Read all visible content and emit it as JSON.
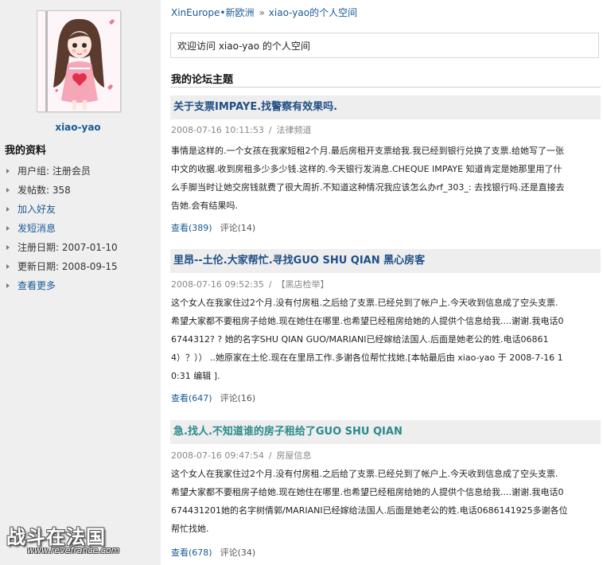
{
  "profile": {
    "username": "xiao-yao",
    "section_title": "我的资料",
    "items": [
      {
        "label": "用户组: 注册会员"
      },
      {
        "label": "发帖数: 358"
      },
      {
        "label": "加入好友"
      },
      {
        "label": "发短消息"
      },
      {
        "label": "注册日期: 2007-01-10"
      },
      {
        "label": "更新日期: 2008-09-15"
      },
      {
        "label": "查看更多"
      }
    ]
  },
  "breadcrumb": {
    "site": "XinEurope•新欧洲",
    "separator": "»",
    "current": "xiao-yao的个人空间"
  },
  "welcome_text": "欢迎访问  xiao-yao 的个人空间",
  "forum_section_title": "我的论坛主题",
  "posts": [
    {
      "title": "关于支票IMPAYE.找警察有效果吗.",
      "date": "2008-07-16 10:11:53",
      "category": "法律频道",
      "body": [
        "事情是这样的.一个女孩在我家短租2个月.最后房租开支票给我.我已经到银行兑换了支票.给她写了一张",
        "中文的收据.收到房租多少多少钱.这样的.今天银行发消息.CHEQUE IMPAYE 知道肯定是她那里用了什",
        "么手脚当时让她交房钱就费了很大周折.不知道这种情况我应该怎么办rf_303_: 去找银行吗.还是直接去",
        "告她.会有结果吗."
      ],
      "views": "查看(389)",
      "comments": "评论(14)"
    },
    {
      "title": "里昂--土伦.大家帮忙.寻找GUO SHU QIAN 黑心房客",
      "date": "2008-07-16 09:52:35",
      "category": "【黑店检举】",
      "body": [
        "这个女人在我家住过2个月.没有付房租.之后给了支票.已经兑到了帐户上.今天收到信息成了空头支票.",
        "希望大家都不要租房子给她.现在她住在哪里.也希望已经租房给她的人提供个信息给我....谢谢.我电话0",
        "6744312? ? 她的名字SHU QIAN GUO/MARIANI已经嫁给法国人.后面是她老公的姓.电话06861",
        "4）？）） ..她原家在土伦.现在在里昂工作.多谢各位帮忙找她.[本帖最后由  xiao-yao 于   2008-7-16 1",
        "0:31 编辑 ]."
      ],
      "views": "查看(647)",
      "comments": "评论(16)"
    },
    {
      "title": "急.找人.不知道谁的房子租给了GUO SHU QIAN",
      "date": "2008-07-16 09:47:54",
      "category": "房屋信息",
      "body": [
        "这个女人在我家住过2个月.没有付房租.之后给了支票.已经兑到了帐户上.今天收到信息成了空头支票.",
        "希望大家都不要租房子给她.现在她住在哪里.也希望已经租房给她的人提供个信息给我....谢谢.我电话0",
        "674431201她的名字树倩郭/MARIANI已经嫁给法国人.后面是她老公的姓.电话0686141925多谢各位",
        "帮忙找她."
      ],
      "views": "查看(678)",
      "comments": "评论(34)"
    }
  ],
  "watermark": {
    "name": "战斗在法国",
    "url": "www.revefrance.com"
  },
  "colors": {
    "link": "#1a5a96",
    "title_blue": "#1f4f86",
    "title_teal": "#2a8a8a",
    "sidebar_bg": "#efefef",
    "title_bar_bg": "#eeeeee"
  }
}
